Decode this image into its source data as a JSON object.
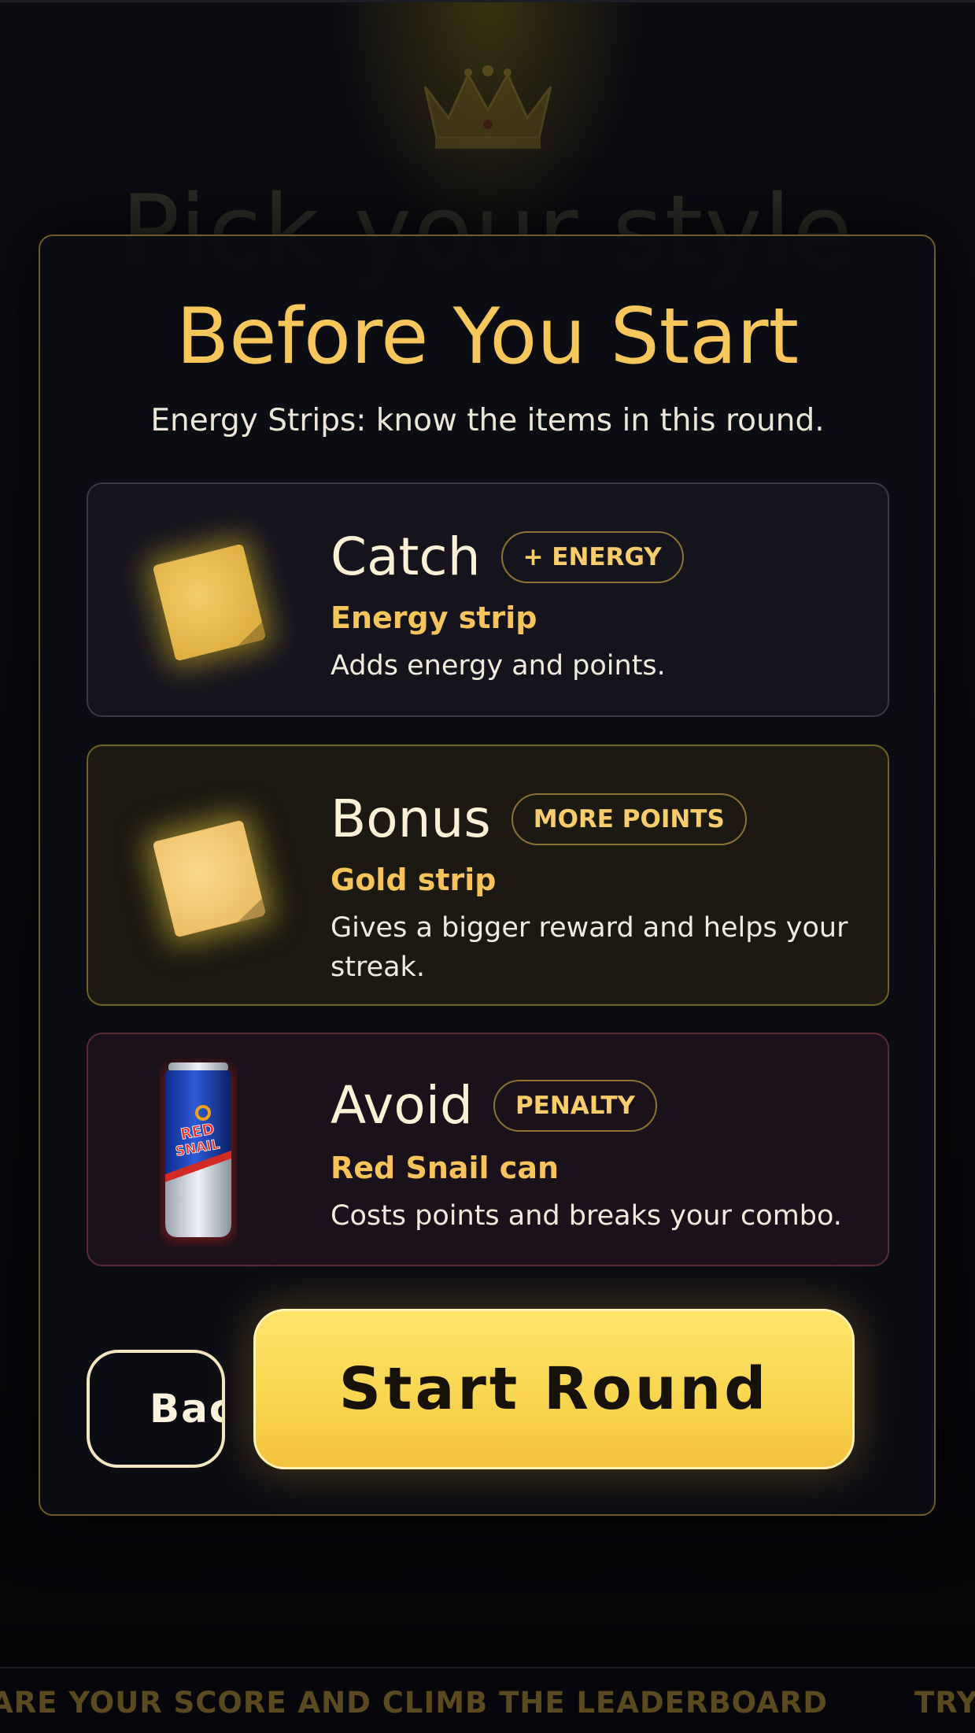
{
  "background": {
    "title": "Pick your style"
  },
  "modal": {
    "title": "Before You Start",
    "subtitle": "Energy Strips: know the items in this round.",
    "items": [
      {
        "heading": "Catch",
        "badge": "+ ENERGY",
        "name": "Energy strip",
        "description": "Adds energy and points.",
        "icon": "energy-strip-icon",
        "accent": "#15141d"
      },
      {
        "heading": "Bonus",
        "badge": "MORE POINTS",
        "name": "Gold strip",
        "description": "Gives a bigger reward and helps your streak.",
        "icon": "gold-strip-icon",
        "accent": "#1b1911"
      },
      {
        "heading": "Avoid",
        "badge": "PENALTY",
        "name": "Red Snail can",
        "description": "Costs points and breaks your combo.",
        "icon": "red-snail-can-icon",
        "accent": "#1b111a",
        "can_label": "RED SNAIL"
      }
    ],
    "back_label": "Back",
    "start_label": "Start Round"
  },
  "ticker": {
    "segments": [
      "ARE YOUR SCORE AND CLIMB THE LEADERBOARD",
      "TRY EN"
    ]
  },
  "colors": {
    "accent_gold": "#f8c75b",
    "button_yellow": "#fad650",
    "background": "#07070b"
  }
}
